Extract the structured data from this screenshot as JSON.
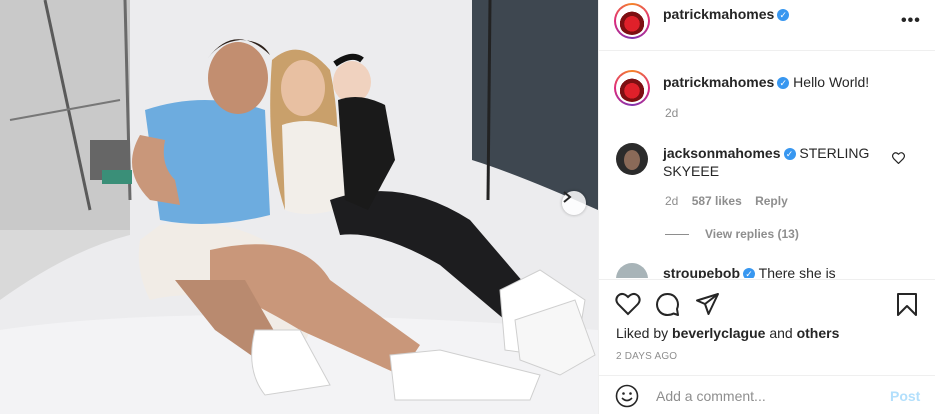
{
  "header": {
    "username": "patrickmahomes",
    "more_label": "•••"
  },
  "caption": {
    "username": "patrickmahomes",
    "text": "Hello World!",
    "time": "2d"
  },
  "comments": [
    {
      "username": "jacksonmahomes",
      "text": "STERLING SKYEEE",
      "time": "2d",
      "likes": "587 likes",
      "reply_label": "Reply",
      "view_replies": "View replies (13)"
    },
    {
      "username": "stroupebob",
      "text": "There she is"
    }
  ],
  "actions": {
    "icons": [
      "heart-icon",
      "comment-icon",
      "share-icon",
      "bookmark-icon"
    ],
    "liked_prefix": "Liked by",
    "liked_user": "beverlyclague",
    "liked_and": "and",
    "liked_others": "others",
    "date": "2 DAYS AGO"
  },
  "add_comment": {
    "placeholder": "Add a comment...",
    "post_label": "Post"
  },
  "colors": {
    "verified": "#3897f0",
    "post_disabled": "#b2dffc",
    "meta": "#8e8e8e",
    "border": "#efefef"
  }
}
